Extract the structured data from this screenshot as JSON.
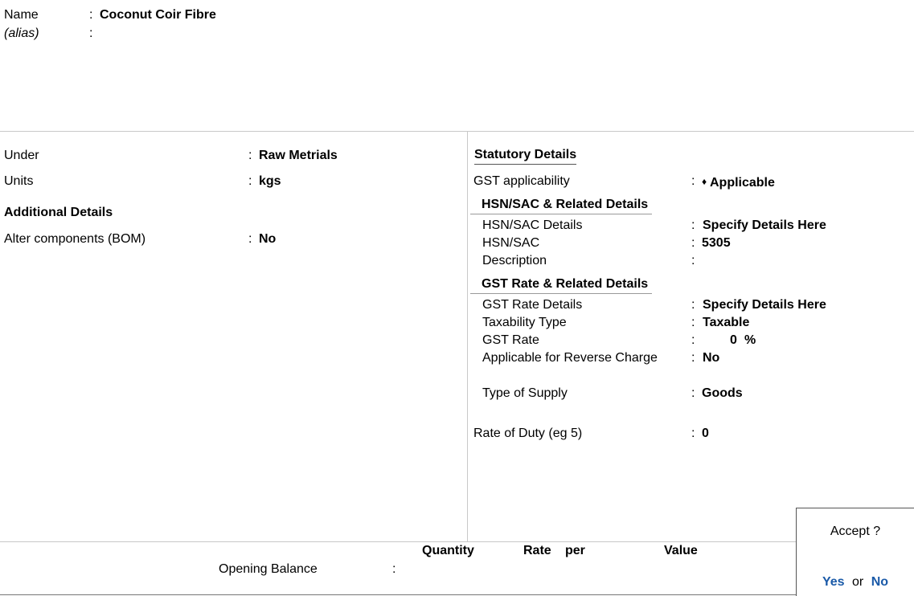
{
  "header": {
    "name_label": "Name",
    "name_value": "Coconut Coir Fibre",
    "alias_label": "(alias)",
    "alias_value": ""
  },
  "left": {
    "under_label": "Under",
    "under_value": "Raw Metrials",
    "units_label": "Units",
    "units_value": "kgs",
    "additional_title": "Additional Details",
    "bom_label": "Alter components (BOM)",
    "bom_value": "No"
  },
  "statutory": {
    "title": "Statutory Details",
    "gst_applicability_label": "GST applicability",
    "gst_applicability_value": "Applicable",
    "gst_applicability_marker": "♦",
    "hsn_section_title": "HSN/SAC & Related Details",
    "hsn_details_label": "HSN/SAC Details",
    "hsn_details_value": "Specify Details Here",
    "hsn_label": "HSN/SAC",
    "hsn_value": "5305",
    "description_label": "Description",
    "description_value": "",
    "gst_rate_section_title": "GST Rate & Related Details",
    "gst_rate_details_label": "GST Rate Details",
    "gst_rate_details_value": "Specify Details Here",
    "taxability_label": "Taxability Type",
    "taxability_value": "Taxable",
    "gst_rate_label": "GST Rate",
    "gst_rate_value": "0",
    "gst_rate_unit": "%",
    "reverse_charge_label": "Applicable for Reverse Charge",
    "reverse_charge_value": "No",
    "supply_type_label": "Type of Supply",
    "supply_type_value": "Goods",
    "rate_of_duty_label": "Rate of Duty (eg 5)",
    "rate_of_duty_value": "0"
  },
  "opening": {
    "quantity_header": "Quantity",
    "rate_header": "Rate",
    "per_header": "per",
    "value_header": "Value",
    "label": "Opening Balance"
  },
  "accept": {
    "title": "Accept ?",
    "yes": "Yes",
    "or": "or",
    "no": "No"
  },
  "colon": ":"
}
